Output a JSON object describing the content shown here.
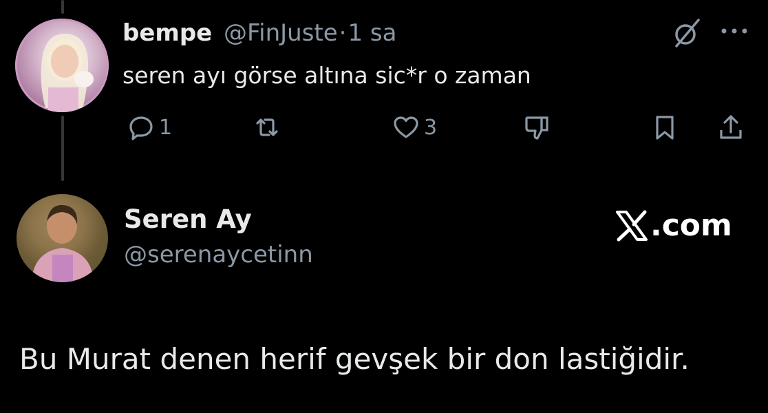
{
  "reply": {
    "display_name": "bempe",
    "handle": "@FinJuste",
    "separator": "·",
    "time": "1 sa",
    "text": "seren ayı görse altına sic*r o zaman",
    "actions": {
      "reply_count": "1",
      "retweet_count": "",
      "like_count": "3"
    }
  },
  "quoted_card": {
    "display_name": "Seren Ay",
    "handle": "@serenaycetinn",
    "brand": ".com",
    "text": "Bu Murat denen herif gevşek bir don lastiğidir."
  },
  "icons": [
    "grok-icon",
    "more-icon",
    "reply-icon",
    "retweet-icon",
    "like-icon",
    "dislike-icon",
    "bookmark-icon",
    "share-icon",
    "x-logo-icon"
  ],
  "colors": {
    "background": "#000000",
    "text": "#e7e9ea",
    "muted": "#8b98a5",
    "thread_line": "#333639"
  }
}
